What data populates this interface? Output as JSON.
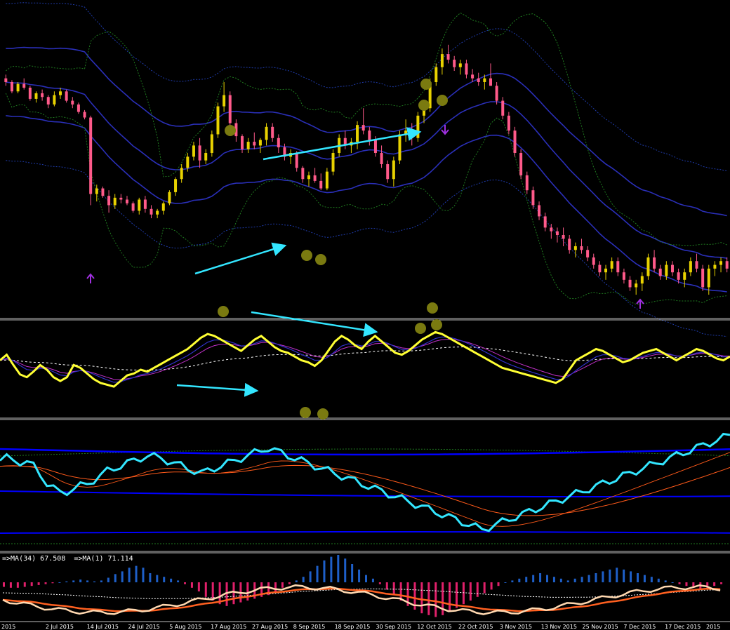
{
  "colors": {
    "background": "#000000",
    "bull_candle": "#e8d200",
    "bear_candle": "#ff5a8a",
    "envelope_blue": "#2a2fb8",
    "envelope_dotted": "#1e3aa8",
    "bands_green": "#1f7a1f",
    "oscillator_main": "#ffff33",
    "oscillator_signal_blue": "#3030c8",
    "oscillator_signal_purple": "#c030c8",
    "oscillator_midline": "#ffffff",
    "panel3_main": "#33e6ff",
    "panel3_envelope": "#0000ff",
    "panel3_orange": "#ff5a1a",
    "hist_up": "#1e5fc8",
    "hist_down": "#e0206a",
    "ma34": "#ff6020",
    "ma1": "#ffd8b0",
    "divergence_arrow": "#33e6ff",
    "marker_dot": "#7a7a10",
    "signal_up_arrow": "#a030e0",
    "signal_down_arrow": "#a030e0"
  },
  "panel4_label": "=>MA(34) 67.508  =>MA(1) 71.114",
  "x_axis_dates": [
    "2015",
    "2 Jul 2015",
    "14 Jul 2015",
    "24 Jul 2015",
    "5 Aug 2015",
    "17 Aug 2015",
    "27 Aug 2015",
    "8 Sep 2015",
    "18 Sep 2015",
    "30 Sep 2015",
    "12 Oct 2015",
    "22 Oct 2015",
    "3 Nov 2015",
    "13 Nov 2015",
    "25 Nov 2015",
    "7 Dec 2015",
    "17 Dec 2015",
    "2015"
  ],
  "chart_data": [
    {
      "type": "candlestick",
      "panel": "price",
      "candles": [
        [
          108,
          110,
          104,
          106
        ],
        [
          106,
          107,
          100,
          101
        ],
        [
          101,
          106,
          100,
          105
        ],
        [
          105,
          108,
          102,
          103
        ],
        [
          103,
          104,
          96,
          97
        ],
        [
          97,
          101,
          95,
          100
        ],
        [
          100,
          102,
          96,
          98
        ],
        [
          98,
          99,
          92,
          94
        ],
        [
          94,
          101,
          93,
          99
        ],
        [
          99,
          103,
          97,
          101
        ],
        [
          101,
          102,
          95,
          96
        ],
        [
          96,
          98,
          92,
          94
        ],
        [
          94,
          95,
          89,
          90
        ],
        [
          90,
          91,
          86,
          87
        ],
        [
          87,
          88,
          40,
          46
        ],
        [
          46,
          51,
          42,
          49
        ],
        [
          49,
          50,
          44,
          45
        ],
        [
          45,
          48,
          36,
          40
        ],
        [
          40,
          46,
          38,
          44
        ],
        [
          44,
          46,
          41,
          43
        ],
        [
          43,
          45,
          40,
          41
        ],
        [
          41,
          42,
          36,
          37
        ],
        [
          37,
          44,
          35,
          43
        ],
        [
          43,
          45,
          36,
          38
        ],
        [
          38,
          40,
          33,
          35
        ],
        [
          35,
          38,
          33,
          37
        ],
        [
          37,
          42,
          35,
          41
        ],
        [
          41,
          48,
          40,
          47
        ],
        [
          47,
          55,
          45,
          54
        ],
        [
          54,
          62,
          52,
          60
        ],
        [
          60,
          68,
          58,
          66
        ],
        [
          66,
          74,
          64,
          72
        ],
        [
          72,
          76,
          60,
          64
        ],
        [
          64,
          70,
          62,
          68
        ],
        [
          68,
          80,
          66,
          78
        ],
        [
          78,
          95,
          76,
          93
        ],
        [
          93,
          106,
          90,
          99
        ],
        [
          99,
          101,
          82,
          84
        ],
        [
          84,
          86,
          74,
          77
        ],
        [
          77,
          78,
          68,
          70
        ],
        [
          70,
          76,
          68,
          74
        ],
        [
          74,
          79,
          70,
          72
        ],
        [
          72,
          76,
          68,
          75
        ],
        [
          75,
          84,
          72,
          82
        ],
        [
          82,
          84,
          74,
          76
        ],
        [
          76,
          78,
          68,
          71
        ],
        [
          71,
          73,
          64,
          66
        ],
        [
          66,
          70,
          62,
          68
        ],
        [
          68,
          69,
          58,
          60
        ],
        [
          60,
          61,
          52,
          54
        ],
        [
          54,
          58,
          50,
          56
        ],
        [
          56,
          60,
          52,
          53
        ],
        [
          53,
          57,
          48,
          49
        ],
        [
          49,
          60,
          48,
          58
        ],
        [
          58,
          70,
          56,
          68
        ],
        [
          68,
          78,
          66,
          76
        ],
        [
          76,
          80,
          70,
          72
        ],
        [
          72,
          76,
          68,
          74
        ],
        [
          74,
          85,
          70,
          83
        ],
        [
          83,
          92,
          78,
          80
        ],
        [
          80,
          82,
          72,
          75
        ],
        [
          75,
          77,
          66,
          68
        ],
        [
          68,
          72,
          60,
          62
        ],
        [
          62,
          64,
          52,
          54
        ],
        [
          54,
          66,
          50,
          64
        ],
        [
          64,
          80,
          62,
          78
        ],
        [
          78,
          86,
          74,
          80
        ],
        [
          80,
          84,
          72,
          76
        ],
        [
          76,
          90,
          74,
          88
        ],
        [
          88,
          94,
          84,
          92
        ],
        [
          92,
          108,
          90,
          106
        ],
        [
          106,
          116,
          104,
          114
        ],
        [
          114,
          124,
          110,
          121
        ],
        [
          121,
          126,
          116,
          118
        ],
        [
          118,
          120,
          112,
          114
        ],
        [
          114,
          118,
          110,
          116
        ],
        [
          116,
          118,
          108,
          110
        ],
        [
          110,
          113,
          106,
          108
        ],
        [
          108,
          111,
          104,
          106
        ],
        [
          106,
          110,
          102,
          108
        ],
        [
          108,
          116,
          104,
          104
        ],
        [
          104,
          106,
          94,
          96
        ],
        [
          96,
          98,
          86,
          88
        ],
        [
          88,
          90,
          78,
          80
        ],
        [
          80,
          82,
          66,
          68
        ],
        [
          68,
          70,
          54,
          56
        ],
        [
          56,
          58,
          46,
          48
        ],
        [
          48,
          50,
          38,
          40
        ],
        [
          40,
          42,
          32,
          34
        ],
        [
          34,
          36,
          26,
          28
        ],
        [
          28,
          30,
          22,
          26
        ],
        [
          26,
          28,
          20,
          24
        ],
        [
          24,
          28,
          18,
          22
        ],
        [
          22,
          24,
          14,
          16
        ],
        [
          16,
          20,
          12,
          18
        ],
        [
          18,
          22,
          14,
          16
        ],
        [
          16,
          18,
          10,
          12
        ],
        [
          12,
          14,
          6,
          8
        ],
        [
          8,
          10,
          2,
          4
        ],
        [
          4,
          8,
          0,
          6
        ],
        [
          6,
          12,
          4,
          10
        ],
        [
          10,
          12,
          2,
          4
        ],
        [
          4,
          6,
          -2,
          0
        ],
        [
          0,
          2,
          -6,
          -4
        ],
        [
          -4,
          0,
          -8,
          -2
        ],
        [
          -2,
          4,
          -6,
          2
        ],
        [
          2,
          14,
          0,
          12
        ],
        [
          12,
          16,
          4,
          6
        ],
        [
          6,
          8,
          0,
          2
        ],
        [
          2,
          10,
          0,
          8
        ],
        [
          8,
          10,
          2,
          4
        ],
        [
          4,
          6,
          -2,
          0
        ],
        [
          0,
          6,
          -4,
          4
        ],
        [
          4,
          12,
          2,
          10
        ],
        [
          10,
          14,
          4,
          6
        ],
        [
          6,
          8,
          -6,
          -4
        ],
        [
          -4,
          8,
          -8,
          6
        ],
        [
          6,
          10,
          2,
          8
        ],
        [
          8,
          12,
          4,
          10
        ],
        [
          10,
          12,
          4,
          6
        ]
      ],
      "ylim": [
        -20,
        150
      ]
    },
    {
      "type": "line",
      "panel": "oscillator",
      "series": [
        {
          "values": [
            60,
            66,
            55,
            45,
            42,
            48,
            55,
            50,
            42,
            38,
            42,
            55,
            52,
            46,
            40,
            36,
            34,
            32,
            38,
            44,
            46,
            50,
            48,
            52,
            56,
            60,
            64,
            68,
            72,
            78,
            84,
            88,
            86,
            82,
            78,
            74,
            70,
            76,
            82,
            86,
            80,
            74,
            70,
            68,
            64,
            60,
            58,
            54,
            60,
            70,
            80,
            86,
            82,
            76,
            72,
            80,
            86,
            80,
            74,
            68,
            66,
            70,
            76,
            82,
            86,
            90,
            88,
            84,
            80,
            76,
            72,
            68,
            64,
            60,
            56,
            52,
            50,
            48,
            46,
            44,
            42,
            40,
            38,
            36,
            40,
            50,
            60,
            64,
            68,
            72,
            70,
            66,
            62,
            58,
            60,
            64,
            68,
            70,
            72,
            68,
            64,
            60,
            64,
            68,
            72,
            70,
            66,
            62,
            60,
            64
          ]
        }
      ],
      "ylim": [
        0,
        100
      ]
    },
    {
      "type": "line",
      "panel": "panel3",
      "series": [
        {
          "values": [
            70,
            72,
            71,
            69,
            68,
            66,
            60,
            52,
            48,
            45,
            46,
            48,
            50,
            52,
            55,
            58,
            62,
            64,
            66,
            68,
            70,
            72,
            74,
            73,
            72,
            70,
            68,
            66,
            64,
            62,
            60,
            62,
            64,
            66,
            68,
            70,
            72,
            74,
            76,
            78,
            80,
            78,
            76,
            74,
            72,
            70,
            68,
            66,
            64,
            62,
            60,
            58,
            56,
            54,
            52,
            50,
            48,
            46,
            44,
            42,
            40,
            38,
            36,
            34,
            32,
            30,
            28,
            26,
            24,
            22,
            20,
            18,
            16,
            18,
            20,
            22,
            24,
            26,
            28,
            30,
            32,
            34,
            36,
            38,
            40,
            42,
            44,
            46,
            48,
            50,
            52,
            54,
            56,
            58,
            60,
            62,
            64,
            66,
            68,
            70,
            72,
            74,
            76,
            78,
            80,
            82,
            84,
            86,
            88,
            90
          ]
        }
      ],
      "ylim": [
        0,
        100
      ]
    },
    {
      "type": "bar",
      "panel": "histogram",
      "title": "=>MA(34) 67.508  =>MA(1) 71.114",
      "values": [
        -5,
        -6,
        -6,
        -5,
        -4,
        -3,
        -2,
        -1,
        0,
        1,
        2,
        3,
        2,
        1,
        2,
        5,
        9,
        12,
        16,
        18,
        16,
        10,
        8,
        6,
        4,
        2,
        -2,
        -6,
        -10,
        -16,
        -20,
        -24,
        -26,
        -24,
        -22,
        -20,
        -18,
        -16,
        -14,
        -10,
        -6,
        -2,
        2,
        6,
        12,
        18,
        24,
        28,
        30,
        26,
        20,
        14,
        8,
        4,
        -2,
        -8,
        -14,
        -20,
        -26,
        -30,
        -34,
        -36,
        -38,
        -36,
        -32,
        -28,
        -24,
        -20,
        -16,
        -12,
        -8,
        -4,
        0,
        2,
        4,
        6,
        8,
        10,
        8,
        6,
        4,
        2,
        4,
        6,
        8,
        10,
        12,
        14,
        16,
        14,
        12,
        10,
        8,
        6,
        4,
        2,
        0,
        -2,
        -4,
        -6,
        -8,
        -6,
        -4,
        -2
      ],
      "series": [
        {
          "name": "MA(34)",
          "last": 67.508
        },
        {
          "name": "MA(1)",
          "last": 71.114
        }
      ]
    }
  ]
}
